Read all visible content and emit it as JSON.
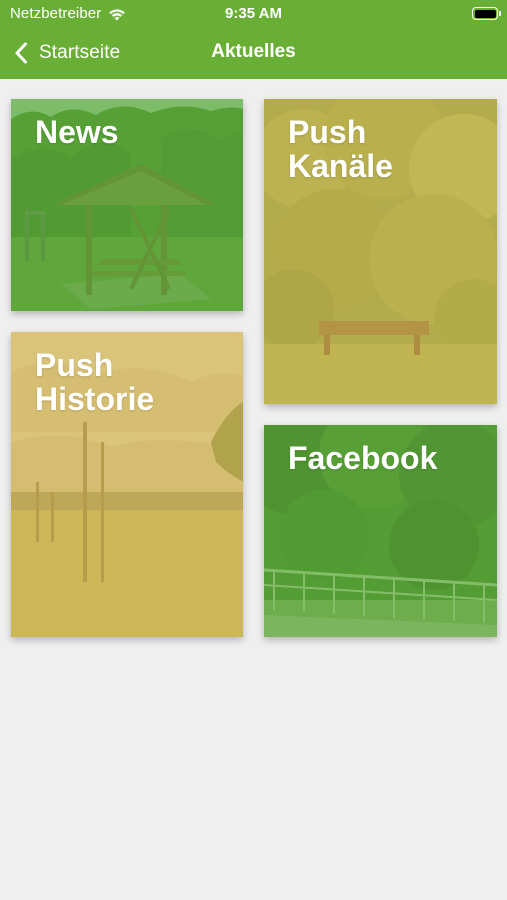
{
  "status_bar": {
    "carrier": "Netzbetreiber",
    "time": "9:35 AM",
    "wifi_icon": "wifi-icon",
    "battery_icon": "battery-icon"
  },
  "nav": {
    "back_label": "Startseite",
    "back_icon": "chevron-left-icon",
    "title": "Aktuelles"
  },
  "colors": {
    "brand_green": "#6aaf35",
    "tile_green_overlay": "#5fb33a",
    "tile_yellow_overlay": "#d6b84d",
    "background": "#efefef"
  },
  "tiles": [
    {
      "label": "News"
    },
    {
      "label": "Push\nKanäle"
    },
    {
      "label": "Push\nHistorie"
    },
    {
      "label": "Facebook"
    }
  ]
}
